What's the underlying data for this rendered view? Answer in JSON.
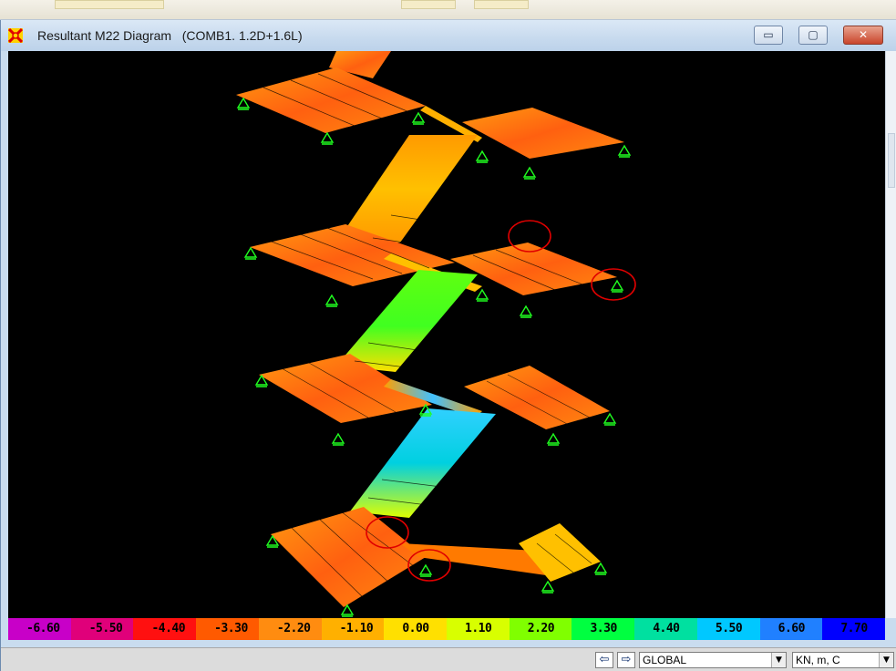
{
  "window": {
    "title": "Resultant M22 Diagram   (COMB1. 1.2D+1.6L)",
    "minimize_glyph": "▭",
    "maximize_glyph": "▢",
    "close_glyph": "✕"
  },
  "legend": {
    "labels": [
      "-6.60",
      "-5.50",
      "-4.40",
      "-3.30",
      "-2.20",
      "-1.10",
      "0.00",
      "1.10",
      "2.20",
      "3.30",
      "4.40",
      "5.50",
      "6.60",
      "7.70"
    ],
    "colors": [
      "#c800c8",
      "#e0007a",
      "#ff1010",
      "#ff5a00",
      "#ff8c10",
      "#ffb000",
      "#ffe000",
      "#d8ff00",
      "#80ff00",
      "#00ff40",
      "#00e0a0",
      "#00c8ff",
      "#2080ff",
      "#0000ff"
    ]
  },
  "statusbar": {
    "prev_glyph": "⇦",
    "next_glyph": "⇨",
    "coord_system": "GLOBAL",
    "units": "KN, m, C"
  },
  "icons": {
    "app": "sap-app-icon",
    "support": "pin-support-icon",
    "markers": "red-circle-highlight"
  }
}
